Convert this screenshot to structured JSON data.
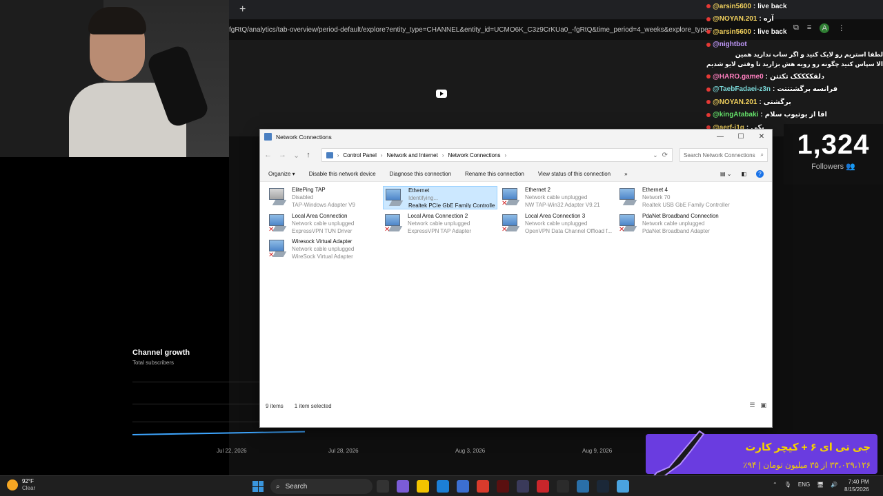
{
  "browser": {
    "url": "fgRtQ/analytics/tab-overview/period-default/explore?entity_type=CHANNEL&entity_id=UCMO6K_C3z9CrKUa0_-fgRtQ&time_period=4_weeks&explore_type=SUBSCRIBER"
  },
  "chat": {
    "lines": [
      {
        "user": "@arsin5600",
        "sep": " : ",
        "msg": "live back",
        "color": "yellow"
      },
      {
        "user": "@NOYAN.201",
        "sep": " : ",
        "msg": "آره",
        "color": "yellow"
      },
      {
        "user": "@arsin5600",
        "sep": " : ",
        "msg": "live back",
        "color": "yellow"
      },
      {
        "user": "@nightbot",
        "sep": "",
        "msg": "",
        "color": "purple"
      },
      {
        "user": "@HARO.game0",
        "sep": " : ",
        "msg": "دلقککککک تکتتن",
        "color": "pink"
      },
      {
        "user": "@TaebFadaei-z3n",
        "sep": " : ",
        "msg": "فرانسه برگشتتتت",
        "color": "cyan"
      },
      {
        "user": "@NOYAN.201",
        "sep": " : ",
        "msg": "برگشتی",
        "color": "yellow"
      },
      {
        "user": "@kingAtabaki",
        "sep": " : ",
        "msg": "اقا از یوتیوب سلام",
        "color": "green"
      },
      {
        "user": "@aerf-j1g",
        "sep": " : ",
        "msg": "یکی",
        "color": "yellow"
      }
    ],
    "nightbot_rtl_1": "لطفا استریم رو لایک کنید و اگر ساب ندارید همین",
    "nightbot_rtl_2": "الا سپاس کنید چگونه رو رویه هش بزارید تا وقتی لایو شدیم با خبر شید"
  },
  "followers": {
    "count": "1,324",
    "label": "Followers"
  },
  "growth": {
    "title": "Channel growth",
    "subtitle": "Total subscribers",
    "dates": [
      "Jul 22, 2026",
      "Jul 28, 2026",
      "Aug 3, 2026",
      "Aug 9, 2026"
    ]
  },
  "window": {
    "title": "Network Connections",
    "breadcrumbs": [
      "Control Panel",
      "Network and Internet",
      "Network Connections"
    ],
    "search_placeholder": "Search Network Connections",
    "commands": [
      "Organize ▾",
      "Disable this network device",
      "Diagnose this connection",
      "Rename this connection",
      "View status of this connection",
      "»"
    ],
    "items": [
      {
        "name": "ElitePing TAP",
        "status": "Disabled",
        "adapter": "TAP-Windows Adapter V9",
        "state": "disabled"
      },
      {
        "name": "Ethernet",
        "status": "Identifying...",
        "adapter": "Realtek PCIe GbE Family Controller",
        "state": "selected"
      },
      {
        "name": "Ethernet 2",
        "status": "Network cable unplugged",
        "adapter": "NW TAP-Win32 Adapter V9.21",
        "state": "unplugged"
      },
      {
        "name": "Ethernet 4",
        "status": "Network 70",
        "adapter": "Realtek USB GbE Family Controller",
        "state": "connected"
      },
      {
        "name": "Local Area Connection",
        "status": "Network cable unplugged",
        "adapter": "ExpressVPN TUN Driver",
        "state": "unplugged"
      },
      {
        "name": "Local Area Connection 2",
        "status": "Network cable unplugged",
        "adapter": "ExpressVPN TAP Adapter",
        "state": "unplugged"
      },
      {
        "name": "Local Area Connection 3",
        "status": "Network cable unplugged",
        "adapter": "OpenVPN Data Channel Offload f...",
        "state": "unplugged"
      },
      {
        "name": "PdaNet Broadband Connection",
        "status": "Network cable unplugged",
        "adapter": "PdaNet Broadband Adapter",
        "state": "unplugged"
      },
      {
        "name": "Wiresock Virtual Adapter",
        "status": "Network cable unplugged",
        "adapter": "WireSock Virtual Adapter",
        "state": "unplugged"
      }
    ],
    "status_count": "9 items",
    "status_selected": "1 item selected"
  },
  "ad": {
    "line1": "جی تی ای ۶ + کیچر کارت",
    "line2": "۳۳،۰۲۹،۱۲۶ از ۳۵ میلیون تومان | ۹۴٪"
  },
  "taskbar": {
    "temp": "92°F",
    "condition": "Clear",
    "search": "Search",
    "lang": "ENG",
    "time": "7:40 PM",
    "date": "8/15/2026"
  }
}
